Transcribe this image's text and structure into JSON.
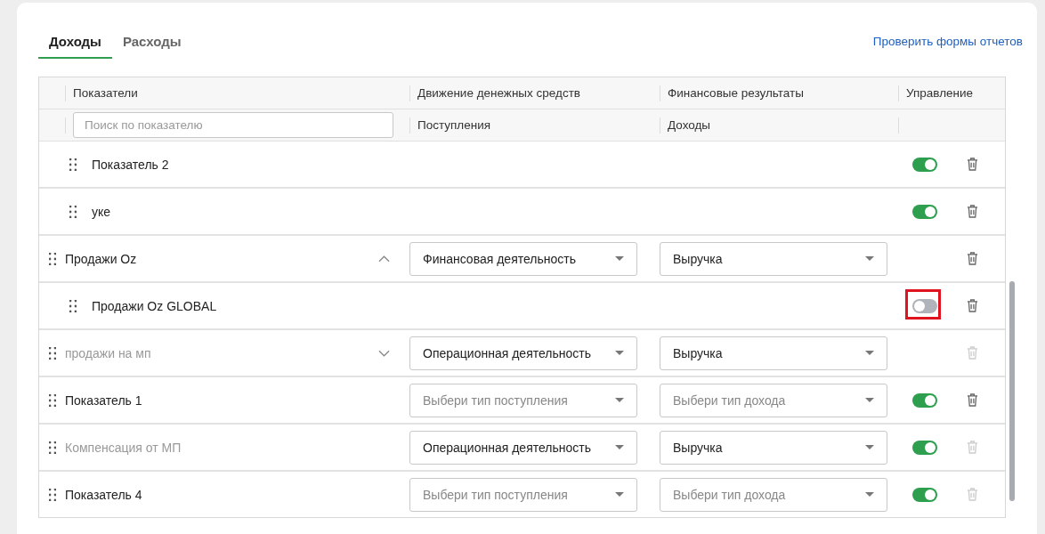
{
  "tabs": [
    {
      "label": "Доходы",
      "selected": true
    },
    {
      "label": "Расходы",
      "selected": false
    }
  ],
  "check_link": "Проверить формы отчетов",
  "table": {
    "columns": [
      "Показатели",
      "Движение денежных средств",
      "Финансовые результаты",
      "Управление"
    ],
    "search": {
      "placeholder": "Поиск по показателю"
    },
    "subheaders": [
      "Поступления",
      "Доходы"
    ],
    "rows": [
      {
        "kind": "child",
        "name": "Показатель 2",
        "inactive": false,
        "enabled": true,
        "highlighted": false,
        "delete_disabled": false
      },
      {
        "kind": "child",
        "name": "уке",
        "inactive": false,
        "enabled": true,
        "highlighted": false,
        "delete_disabled": false
      },
      {
        "kind": "parent",
        "name": "Продажи Oz",
        "inactive": false,
        "expanded": true,
        "cash_flow": {
          "value": "Финансовая деятельность"
        },
        "result": {
          "value": "Выручка"
        },
        "delete_disabled": false,
        "highlighted": false
      },
      {
        "kind": "child",
        "name": "Продажи Oz GLOBAL",
        "inactive": false,
        "enabled": false,
        "highlighted": true,
        "delete_disabled": false
      },
      {
        "kind": "parent",
        "name": "продажи на мп",
        "inactive": true,
        "expanded": false,
        "cash_flow": {
          "value": "Операционная деятельность"
        },
        "result": {
          "value": "Выручка"
        },
        "delete_disabled": true,
        "highlighted": false
      },
      {
        "kind": "item",
        "name": "Показатель 1",
        "inactive": false,
        "cash_flow": {
          "placeholder": "Выбери тип поступления"
        },
        "result": {
          "placeholder": "Выбери тип дохода"
        },
        "enabled": true,
        "delete_disabled": false,
        "highlighted": false
      },
      {
        "kind": "item",
        "name": "Компенсация от МП",
        "inactive": true,
        "cash_flow": {
          "value": "Операционная деятельность"
        },
        "result": {
          "value": "Выручка"
        },
        "enabled": true,
        "delete_disabled": true,
        "highlighted": false
      },
      {
        "kind": "item",
        "name": "Показатель 4",
        "inactive": false,
        "cash_flow": {
          "placeholder": "Выбери тип поступления"
        },
        "result": {
          "placeholder": "Выбери тип дохода"
        },
        "enabled": true,
        "delete_disabled": true,
        "highlighted": false
      }
    ]
  }
}
